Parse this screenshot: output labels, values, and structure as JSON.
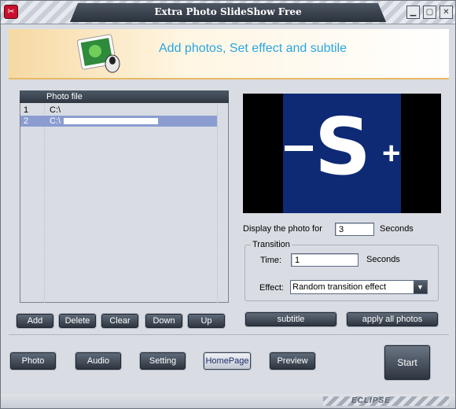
{
  "window": {
    "title": "Extra Photo SlideShow Free"
  },
  "header": {
    "subtitle": "Add photos, Set effect and subtile"
  },
  "list": {
    "column_header": "Photo file",
    "rows": [
      {
        "num": "1",
        "path": "C:\\"
      },
      {
        "num": "2",
        "path": "C:\\"
      }
    ],
    "selected_index": 2
  },
  "preview": {
    "minus": "-",
    "letter": "S",
    "plus": "+"
  },
  "display": {
    "label": "Display the photo for",
    "value": "3",
    "unit": "Seconds"
  },
  "transition": {
    "group_label": "Transition",
    "time_label": "Time:",
    "time_value": "1",
    "time_unit": "Seconds",
    "effect_label": "Effect:",
    "effect_value": "Random transition effect"
  },
  "buttons": {
    "add": "Add",
    "delete": "Delete",
    "clear": "Clear",
    "down": "Down",
    "up": "Up",
    "subtitle": "subtitle",
    "apply_all": "apply all photos",
    "photo": "Photo",
    "audio": "Audio",
    "setting": "Setting",
    "homepage": "HomePage",
    "preview": "Preview",
    "start": "Start"
  },
  "brand": "ECLIPSE"
}
